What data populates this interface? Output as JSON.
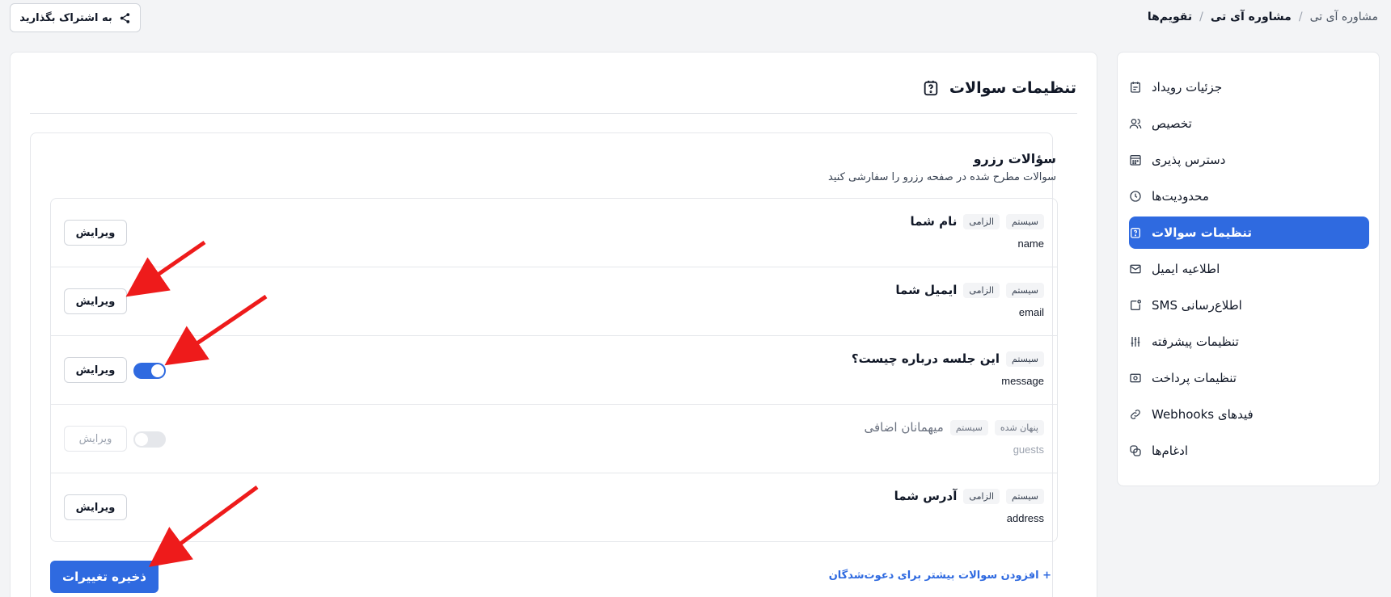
{
  "breadcrumb": {
    "root": "تقویم‌ها",
    "parent": "مشاوره آی تی",
    "current": "مشاوره آی تی",
    "separator": "/"
  },
  "share_button": {
    "label": "به اشتراک بگذارید",
    "icon": "share-icon"
  },
  "sidebar": {
    "items": [
      {
        "label": "جزئیات رویداد",
        "icon": "calendar-note-icon",
        "active": false
      },
      {
        "label": "تخصیص",
        "icon": "users-icon",
        "active": false
      },
      {
        "label": "دسترس پذیری",
        "icon": "calendar-grid-icon",
        "active": false
      },
      {
        "label": "محدودیت‌ها",
        "icon": "clock-icon",
        "active": false
      },
      {
        "label": "تنظیمات سوالات",
        "icon": "question-icon",
        "active": true
      },
      {
        "label": "اطلاعیه ایمیل",
        "icon": "mail-icon",
        "active": false
      },
      {
        "label": "اطلاع‌رسانی SMS",
        "icon": "sms-icon",
        "active": false
      },
      {
        "label": "تنظیمات پیشرفته",
        "icon": "sliders-icon",
        "active": false
      },
      {
        "label": "تنظیمات پرداخت",
        "icon": "payment-icon",
        "active": false
      },
      {
        "label": "فیدهای Webhooks",
        "icon": "link-icon",
        "active": false
      },
      {
        "label": "ادغام‌ها",
        "icon": "integrations-icon",
        "active": false
      }
    ]
  },
  "main": {
    "title": "تنظیمات سوالات",
    "section_title": "سؤالات رزرو",
    "section_subtitle": "سوالات مطرح شده در صفحه رزرو را سفارشی کنید",
    "edit_label": "ویرایش",
    "questions": [
      {
        "title": "نام شما",
        "key": "name",
        "badges": [
          "الزامی",
          "سیستم"
        ],
        "toggle": null,
        "disabled": false
      },
      {
        "title": "ایمیل شما",
        "key": "email",
        "badges": [
          "الزامی",
          "سیستم"
        ],
        "toggle": null,
        "disabled": false
      },
      {
        "title": "این جلسه درباره چیست؟",
        "key": "message",
        "badges": [
          "سیستم"
        ],
        "toggle": "on",
        "disabled": false
      },
      {
        "title": "میهمانان اضافی",
        "key": "guests",
        "badges": [
          "سیستم",
          "پنهان شده"
        ],
        "toggle": "off",
        "disabled": true
      },
      {
        "title": "آدرس شما",
        "key": "address",
        "badges": [
          "الزامی",
          "سیستم"
        ],
        "toggle": null,
        "disabled": false
      }
    ],
    "add_link": "+ افزودن سوالات بیشتر برای دعوت‌شدگان",
    "save_button": "ذخیره تغییرات"
  },
  "colors": {
    "accent": "#2f6ae0",
    "annotation_arrow": "#ee1b1b"
  }
}
